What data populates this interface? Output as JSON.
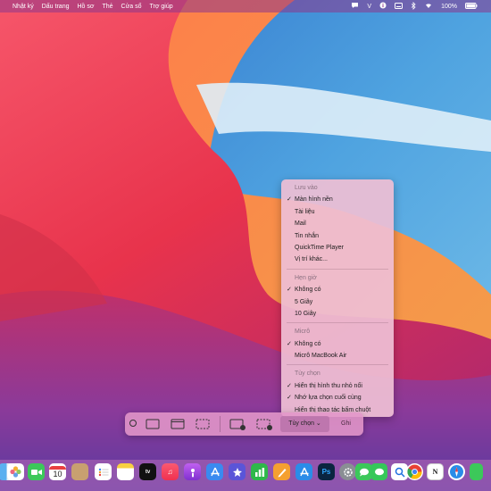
{
  "menubar": {
    "apple": "",
    "items": [
      "Nhật ký",
      "Dấu trang",
      "Hồ sơ",
      "Thẻ",
      "Cửa sổ",
      "Trợ giúp"
    ],
    "battery": "100%",
    "status_icons": [
      "chat-bubble-icon",
      "vpn-icon",
      "info-icon",
      "keyboard-icon",
      "bluetooth-icon",
      "wifi-icon",
      "battery-icon",
      "apple-menu-right-icon"
    ]
  },
  "context_menu": {
    "save_to_header": "Lưu vào",
    "save_to": [
      {
        "label": "Màn hình nền",
        "checked": true
      },
      {
        "label": "Tài liệu",
        "checked": false
      },
      {
        "label": "Mail",
        "checked": false
      },
      {
        "label": "Tin nhắn",
        "checked": false
      },
      {
        "label": "QuickTime Player",
        "checked": false
      },
      {
        "label": "Vị trí khác...",
        "checked": false
      }
    ],
    "timer_header": "Hẹn giờ",
    "timer": [
      {
        "label": "Không có",
        "checked": true
      },
      {
        "label": "5 Giây",
        "checked": false
      },
      {
        "label": "10 Giây",
        "checked": false
      }
    ],
    "mic_header": "Micrô",
    "mic": [
      {
        "label": "Không có",
        "checked": true
      },
      {
        "label": "Micrô MacBook Air",
        "checked": false
      }
    ],
    "options_header": "Tùy chọn",
    "options": [
      {
        "label": "Hiển thị hình thu nhỏ nổi",
        "checked": true
      },
      {
        "label": "Nhớ lựa chọn cuối cùng",
        "checked": true
      },
      {
        "label": "Hiển thị thao tác bấm chuột",
        "checked": false
      }
    ],
    "checkmark": "✓"
  },
  "toolbar": {
    "options_label": "Tùy chọn ⌄",
    "capture_label": "Ghi"
  },
  "dock": {
    "calendar_day": "10",
    "icons": [
      "finder-icon",
      "photos-icon",
      "facetime-icon",
      "calendar-icon",
      "contacts-icon",
      "reminders-icon",
      "notes-icon",
      "appletv-icon",
      "music-icon",
      "podcasts-icon",
      "app-store-icon",
      "keynote-icon",
      "numbers-icon",
      "pages-icon",
      "photoshop-icon",
      "system-preferences-icon",
      "messages-icon",
      "chrome-icon",
      "notion-icon",
      "safari-icon",
      "line-icon"
    ]
  },
  "colors": {
    "menu_bg": "#eebed4",
    "toolbar_bg": "#e296c8",
    "accent": "#c8417a"
  }
}
